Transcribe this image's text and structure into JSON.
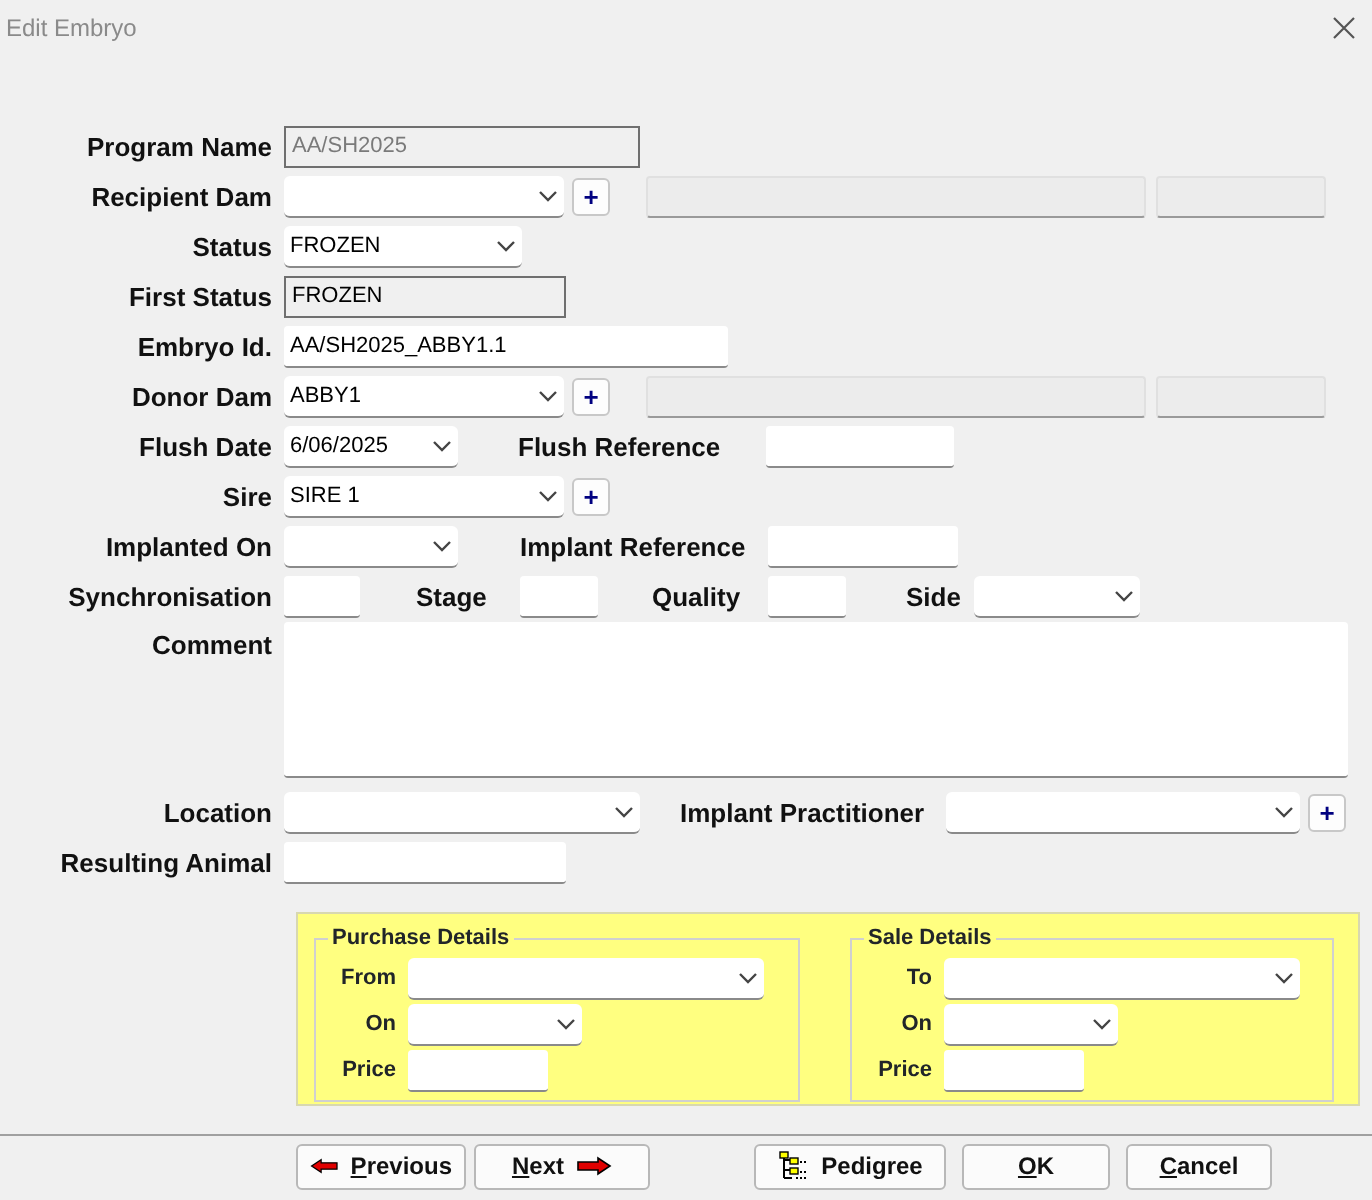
{
  "window": {
    "title": "Edit Embryo"
  },
  "rows": [
    {
      "label": "Program Name",
      "fields": [
        {
          "kind": "readonly",
          "value": "AA/SH2025",
          "disabled": true
        }
      ]
    },
    {
      "label": "Recipient Dam",
      "fields": [
        {
          "kind": "select"
        },
        {
          "kind": "plus",
          "text": "+"
        },
        {
          "kind": "blank"
        },
        {
          "kind": "blank"
        }
      ]
    },
    {
      "label": "Status",
      "fields": [
        {
          "kind": "select",
          "value": "FROZEN"
        }
      ]
    },
    {
      "label": "First Status",
      "fields": [
        {
          "kind": "readonly",
          "value": "FROZEN",
          "disabled": false
        }
      ]
    },
    {
      "label": "Embryo Id.",
      "fields": [
        {
          "kind": "text",
          "value": "AA/SH2025_ABBY1.1"
        }
      ]
    },
    {
      "label": "Donor Dam",
      "fields": [
        {
          "kind": "select",
          "value": "ABBY1"
        },
        {
          "kind": "plus",
          "text": "+"
        },
        {
          "kind": "blank"
        },
        {
          "kind": "blank"
        }
      ]
    },
    {
      "label": "Flush Date",
      "fields": [
        {
          "kind": "select",
          "value": "6/06/2025"
        },
        {
          "kind": "label",
          "text": "Flush Reference"
        },
        {
          "kind": "text"
        }
      ]
    },
    {
      "label": "Sire",
      "fields": [
        {
          "kind": "select",
          "value": "SIRE 1"
        },
        {
          "kind": "plus",
          "text": "+"
        }
      ]
    },
    {
      "label": "Implanted On",
      "fields": [
        {
          "kind": "select"
        },
        {
          "kind": "label",
          "text": "Implant Reference"
        },
        {
          "kind": "text"
        }
      ]
    },
    {
      "label": "Synchronisation",
      "fields": [
        {
          "kind": "text"
        },
        {
          "kind": "label",
          "text": "Stage"
        },
        {
          "kind": "text"
        },
        {
          "kind": "label",
          "text": "Quality"
        },
        {
          "kind": "text"
        },
        {
          "kind": "label",
          "text": "Side"
        },
        {
          "kind": "select"
        }
      ]
    },
    {
      "label": "Comment",
      "fields": [
        {
          "kind": "textarea"
        }
      ]
    },
    {
      "label": "Location",
      "fields": [
        {
          "kind": "select"
        },
        {
          "kind": "label",
          "text": "Implant Practitioner"
        },
        {
          "kind": "select"
        },
        {
          "kind": "plus",
          "text": "+"
        }
      ]
    },
    {
      "label": "Resulting Animal",
      "fields": [
        {
          "kind": "text"
        }
      ]
    }
  ],
  "groups": [
    {
      "title": "Purchase Details",
      "rows": [
        {
          "label": "From",
          "kind": "select"
        },
        {
          "label": "On",
          "kind": "select"
        },
        {
          "label": "Price",
          "kind": "text"
        }
      ]
    },
    {
      "title": "Sale Details",
      "rows": [
        {
          "label": "To",
          "kind": "select"
        },
        {
          "label": "On",
          "kind": "select"
        },
        {
          "label": "Price",
          "kind": "text"
        }
      ]
    }
  ],
  "buttons": [
    {
      "label": "Previous",
      "kind": "previous",
      "underline_first": true
    },
    {
      "label": "Next",
      "kind": "next",
      "underline_first": true
    },
    {
      "label": "Pedigree",
      "kind": "pedigree",
      "underline_first": false
    },
    {
      "label": "OK",
      "kind": "plain",
      "underline_first": true
    },
    {
      "label": "Cancel",
      "kind": "plain",
      "underline_first": true
    }
  ]
}
